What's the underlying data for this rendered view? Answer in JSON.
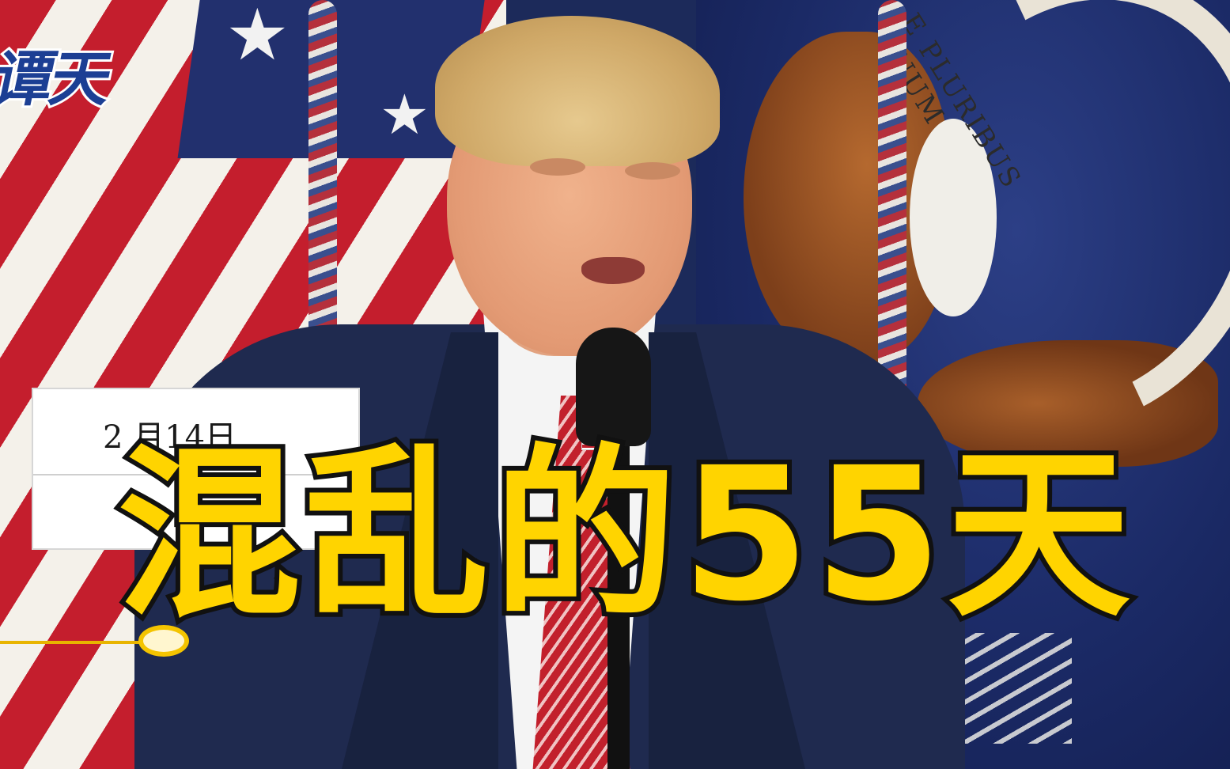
{
  "overlay": {
    "logo_text": "谭天",
    "date_label": "2 月14日",
    "headline": "混乱的55天"
  },
  "background": {
    "seal_motto": "E PLURIBUS UNUM"
  },
  "colors": {
    "headline_fill": "#ffd400",
    "headline_stroke": "#111111",
    "logo_blue": "#1c3f94",
    "timeline_accent": "#f4c400",
    "flag_red": "#c41e2d",
    "flag_blue": "#22306e",
    "suit_navy": "#1f2a4f"
  }
}
